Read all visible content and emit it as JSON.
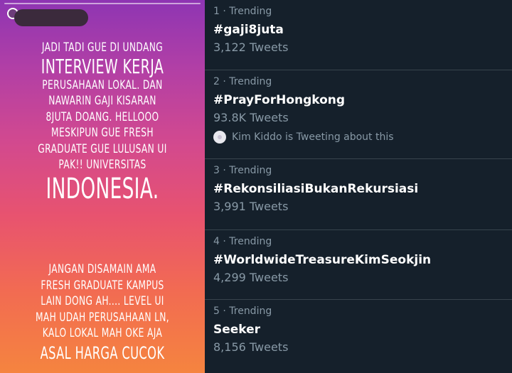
{
  "story": {
    "paragraph1": [
      "JADI TADI GUE DI UNDANG",
      "INTERVIEW KERJA",
      "PERUSAHAAN LOKAL. DAN",
      "NAWARIN GAJI KISARAN",
      "8JUTA DOANG. HELLOOO",
      "MESKIPUN GUE FRESH",
      "GRADUATE GUE LULUSAN UI",
      "PAK!! UNIVERSITAS",
      "INDONESIA."
    ],
    "paragraph2": [
      "JANGAN DISAMAIN AMA",
      "FRESH GRADUATE KAMPUS",
      "LAIN DONG AH.... LEVEL UI",
      "MAH UDAH PERUSAHAAN LN,",
      "KALO LOKAL MAH OKE AJA",
      "ASAL HARGA CUCOK"
    ],
    "colors": {
      "gradient_top": "#8e35b3",
      "gradient_bottom": "#f5843f",
      "text": "#ffffff"
    }
  },
  "trends": {
    "items": [
      {
        "meta": "1 · Trending",
        "name": "#gaji8juta",
        "count": "3,122 Tweets"
      },
      {
        "meta": "2 · Trending",
        "name": "#PrayForHongkong",
        "count": "93.8K Tweets",
        "context": "Kim Kiddo is Tweeting about this"
      },
      {
        "meta": "3 · Trending",
        "name": "#RekonsiliasiBukanRekursiasi",
        "count": "3,991 Tweets"
      },
      {
        "meta": "4 · Trending",
        "name": "#WorldwideTreasureKimSeokjin",
        "count": "4,299 Tweets"
      },
      {
        "meta": "5 · Trending",
        "name": "Seeker",
        "count": "8,156 Tweets"
      }
    ],
    "colors": {
      "background": "#15202b",
      "secondary_text": "#8899a6",
      "primary_text": "#ffffff",
      "divider": "#38444d"
    }
  }
}
